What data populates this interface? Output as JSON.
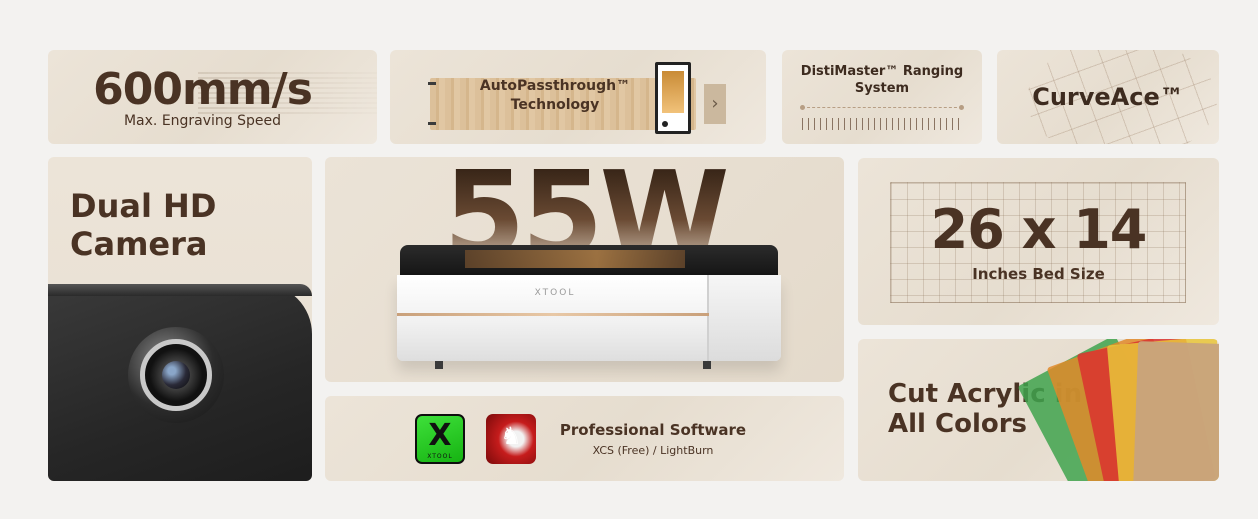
{
  "speed": {
    "value": "600mm/s",
    "label": "Max. Engraving Speed"
  },
  "passthrough": {
    "title": "AutoPassthrough™ Technology"
  },
  "distimaster": {
    "title": "DistiMaster™ Ranging System"
  },
  "curveace": {
    "title": "CurveAce™"
  },
  "camera": {
    "title": "Dual HD Camera"
  },
  "laser": {
    "power": "55W",
    "brand": "XTOOL"
  },
  "bed": {
    "size": "26 x 14",
    "label": "Inches Bed Size"
  },
  "software": {
    "title": "Professional Software",
    "subtitle": "XCS (Free) / LightBurn",
    "xcs_icon_text": "XTOOL"
  },
  "acrylic": {
    "title": "Cut Acrylic in All Colors"
  },
  "colors": {
    "text_brown": "#4a3324",
    "card_bg": "#ece4d8",
    "xcs_green": "#22c41e",
    "lightburn_red": "#c61c1c"
  },
  "icons": [
    "chevron-right-icon",
    "xcs-app-icon",
    "lightburn-app-icon"
  ]
}
